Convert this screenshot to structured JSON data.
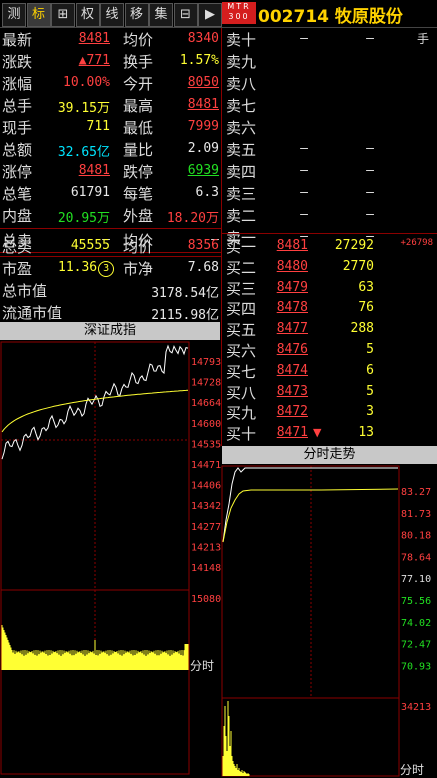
{
  "toolbar": {
    "buttons": [
      {
        "label": "测",
        "active": false
      },
      {
        "label": "标",
        "active": true
      },
      {
        "label": "⊞",
        "active": false
      },
      {
        "label": "权",
        "active": false
      },
      {
        "label": "线",
        "active": false
      },
      {
        "label": "移",
        "active": false
      },
      {
        "label": "集",
        "active": false
      },
      {
        "label": "⊟",
        "active": false
      },
      {
        "label": "▶",
        "active": false
      }
    ],
    "badge_top": "MTR",
    "badge_bottom": "300",
    "stock_code": "002714",
    "stock_name": "牧原股份",
    "corner_label": "手"
  },
  "quote": {
    "latest_label": "最新",
    "latest": "8481",
    "avg_label": "均价",
    "avg": "8340",
    "change_label": "涨跌",
    "change": "▲771",
    "turnover_label": "换手",
    "turnover": "1.57%",
    "pct_label": "涨幅",
    "pct": "10.00%",
    "open_label": "今开",
    "open": "8050",
    "volume_label": "总手",
    "volume": "39.15万",
    "high_label": "最高",
    "high": "8481",
    "current_label": "现手",
    "current": "711",
    "low_label": "最低",
    "low": "7999",
    "amount_label": "总额",
    "amount": "32.65亿",
    "vol_ratio_label": "量比",
    "vol_ratio": "2.09",
    "limit_up_label": "涨停",
    "limit_up": "8481",
    "limit_down_label": "跌停",
    "limit_down": "6939",
    "trades_label": "总笔",
    "trades": "61791",
    "per_trade_label": "每笔",
    "per_trade": "6.3",
    "inner_label": "内盘",
    "inner": "20.95万",
    "outer_label": "外盘",
    "outer": "18.20万",
    "total_sell_label": "总卖",
    "total_sell": "—",
    "total_sell_avg_label": "均价",
    "total_sell_avg": "—",
    "total_buy_label": "总买",
    "total_buy": "45555",
    "total_buy_avg_label": "均价",
    "total_buy_avg": "8356",
    "pe_label": "市盈",
    "pe": "11.36",
    "pe_badge": "3",
    "pb_label": "市净",
    "pb": "7.68",
    "mcap_label": "总市值",
    "mcap": "3178.54亿",
    "float_mcap_label": "流通市值",
    "float_mcap": "2115.98亿"
  },
  "asks": [
    {
      "label": "卖十",
      "price": "—",
      "vol": "—"
    },
    {
      "label": "卖九",
      "price": "",
      "vol": ""
    },
    {
      "label": "卖八",
      "price": "",
      "vol": ""
    },
    {
      "label": "卖七",
      "price": "",
      "vol": ""
    },
    {
      "label": "卖六",
      "price": "",
      "vol": ""
    },
    {
      "label": "卖五",
      "price": "—",
      "vol": "—"
    },
    {
      "label": "卖四",
      "price": "—",
      "vol": "—"
    },
    {
      "label": "卖三",
      "price": "—",
      "vol": "—"
    },
    {
      "label": "卖二",
      "price": "—",
      "vol": "—"
    },
    {
      "label": "卖一",
      "price": "—",
      "vol": "—"
    }
  ],
  "bids": [
    {
      "label": "买一",
      "price": "8481",
      "vol": "27292",
      "delta": "+26798"
    },
    {
      "label": "买二",
      "price": "8480",
      "vol": "2770",
      "delta": ""
    },
    {
      "label": "买三",
      "price": "8479",
      "vol": "63",
      "delta": ""
    },
    {
      "label": "买四",
      "price": "8478",
      "vol": "76",
      "delta": ""
    },
    {
      "label": "买五",
      "price": "8477",
      "vol": "288",
      "delta": ""
    },
    {
      "label": "买六",
      "price": "8476",
      "vol": "5",
      "delta": ""
    },
    {
      "label": "买七",
      "price": "8474",
      "vol": "6",
      "delta": ""
    },
    {
      "label": "买八",
      "price": "8473",
      "vol": "5",
      "delta": ""
    },
    {
      "label": "买九",
      "price": "8472",
      "vol": "3",
      "delta": ""
    },
    {
      "label": "买十",
      "price": "8471",
      "vol": "13",
      "delta": ""
    }
  ],
  "index_panel": {
    "title": "深证成指",
    "price_ticks": [
      "14793",
      "14728",
      "14664",
      "14600",
      "14535",
      "14471",
      "14406",
      "14342",
      "14277",
      "14213",
      "14148"
    ],
    "volume_tick": "15080",
    "time_label": "分时"
  },
  "stock_panel": {
    "title": "分时走势",
    "price_ticks": [
      "83.27",
      "81.73",
      "80.18",
      "78.64",
      "77.10",
      "75.56",
      "74.02",
      "72.47",
      "70.93"
    ],
    "volume_tick": "34213",
    "time_label": "分时"
  },
  "colors": {
    "up": "#ff4040",
    "down": "#22e022",
    "border": "#8b0000",
    "price_line": "#ffffff",
    "avg_line": "#ffff33"
  }
}
